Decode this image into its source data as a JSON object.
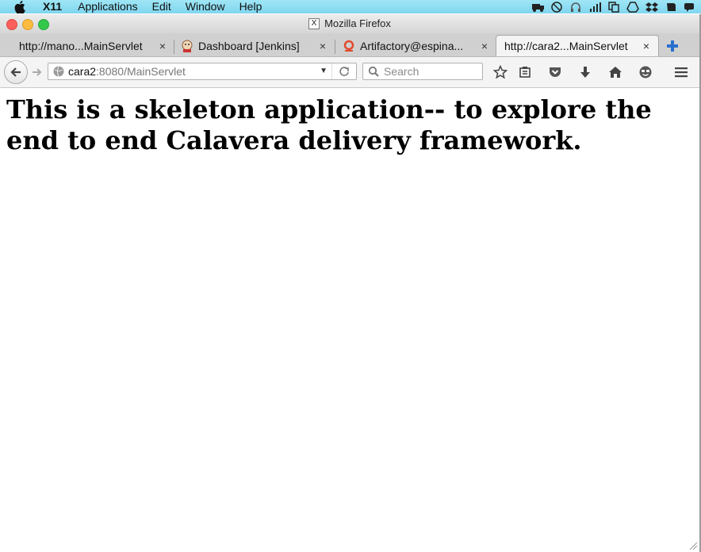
{
  "menubar": {
    "app_name": "X11",
    "items": [
      "Applications",
      "Edit",
      "Window",
      "Help"
    ]
  },
  "window": {
    "title": "Mozilla Firefox"
  },
  "tabs": [
    {
      "label": "http://mano...MainServlet",
      "active": false
    },
    {
      "label": "Dashboard [Jenkins]",
      "active": false
    },
    {
      "label": "Artifactory@espina...",
      "active": false
    },
    {
      "label": "http://cara2...MainServlet",
      "active": true
    }
  ],
  "tab_close_glyph": "×",
  "navbar": {
    "url_host": "cara2",
    "url_path": ":8080/MainServlet",
    "search_placeholder": "Search"
  },
  "page": {
    "heading": "This is a skeleton application-- to explore the end to end Calavera delivery framework."
  },
  "icons": {
    "toolbar": [
      "bookmark-star-icon",
      "reading-list-icon",
      "pocket-icon",
      "download-icon",
      "home-icon",
      "smiley-icon",
      "hamburger-menu-icon"
    ]
  },
  "colors": {
    "menubar_bg": "#8fdcf2",
    "active_tab_bg": "#f4f4f4",
    "newtab_plus": "#2a6fcf"
  }
}
